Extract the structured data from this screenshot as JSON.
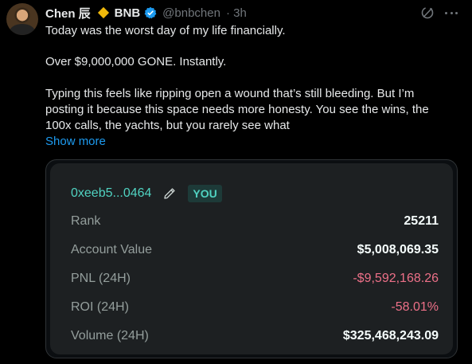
{
  "author": {
    "display_name": "Chen 辰",
    "affiliation": "BNB",
    "handle": "@bnbchen",
    "time": "· 3h",
    "affiliation_color": "#f0b90b",
    "verified_color": "#1d9bf0"
  },
  "tweet": {
    "line1": "Today was the worst day of my life financially.",
    "line2": "Over $9,000,000 GONE. Instantly.",
    "line3": "Typing this feels like ripping open a wound that’s still bleeding. But I’m",
    "line4": "posting it because this space needs more honesty. You see the wins, the",
    "line5": "100x calls, the yachts, but you rarely see what",
    "show_more": "Show more"
  },
  "card": {
    "address": "0xeeb5...0464",
    "badge": "YOU",
    "accent_color": "#50d2c1",
    "negative_color": "#ed7088",
    "stats": [
      {
        "label": "Rank",
        "value": "25211",
        "negative": false
      },
      {
        "label": "Account Value",
        "value": "$5,008,069.35",
        "negative": false
      },
      {
        "label": "PNL (24H)",
        "value": "-$9,592,168.26",
        "negative": true
      },
      {
        "label": "ROI (24H)",
        "value": "-58.01%",
        "negative": true
      },
      {
        "label": "Volume (24H)",
        "value": "$325,468,243.09",
        "negative": false
      }
    ]
  },
  "icons": {
    "avatar": "avatar",
    "affiliation": "bnb-diamond-icon",
    "verified": "verified-badge-icon",
    "grok": "grok-icon",
    "more": "more-icon",
    "edit": "pencil-icon"
  }
}
